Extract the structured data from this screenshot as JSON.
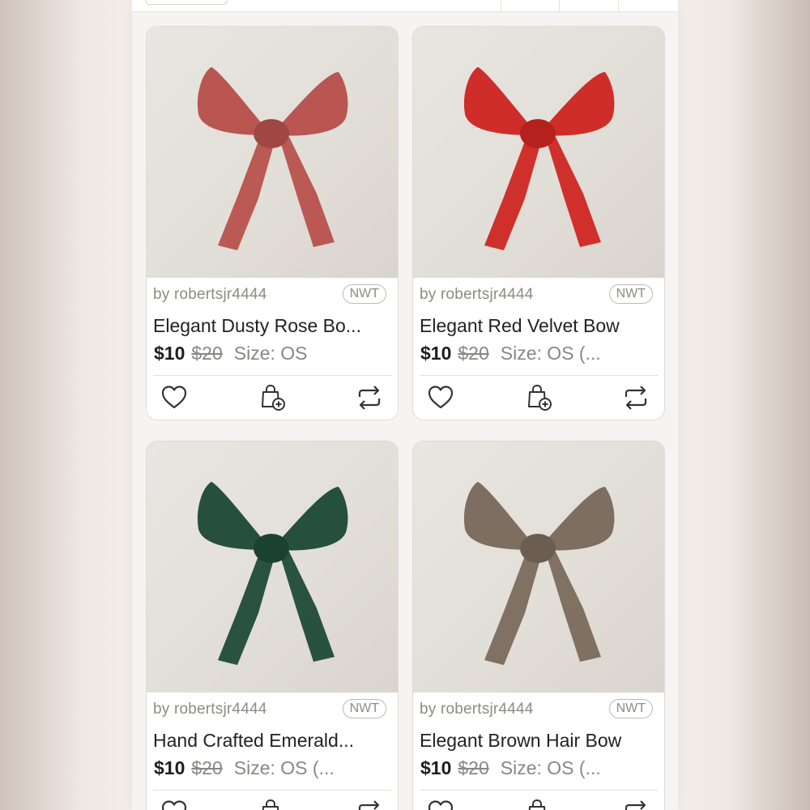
{
  "listings": [
    {
      "seller": "by robertsjr4444",
      "badge": "NWT",
      "title": "Elegant Dusty Rose Bo...",
      "price": "$10",
      "original_price": "$20",
      "size": "Size: OS",
      "bow_color": "#b8514d"
    },
    {
      "seller": "by robertsjr4444",
      "badge": "NWT",
      "title": "Elegant Red Velvet Bow",
      "price": "$10",
      "original_price": "$20",
      "size": "Size: OS (...",
      "bow_color": "#cf2622"
    },
    {
      "seller": "by robertsjr4444",
      "badge": "NWT",
      "title": "Hand Crafted Emerald...",
      "price": "$10",
      "original_price": "$20",
      "size": "Size: OS (...",
      "bow_color": "#1f4a38"
    },
    {
      "seller": "by robertsjr4444",
      "badge": "NWT",
      "title": "Elegant Brown Hair Bow",
      "price": "$10",
      "original_price": "$20",
      "size": "Size: OS (...",
      "bow_color": "#7a6a5c"
    }
  ],
  "icons": {
    "like": "heart-icon",
    "bundle": "shopping-bag-plus-icon",
    "share": "share-repost-icon"
  }
}
